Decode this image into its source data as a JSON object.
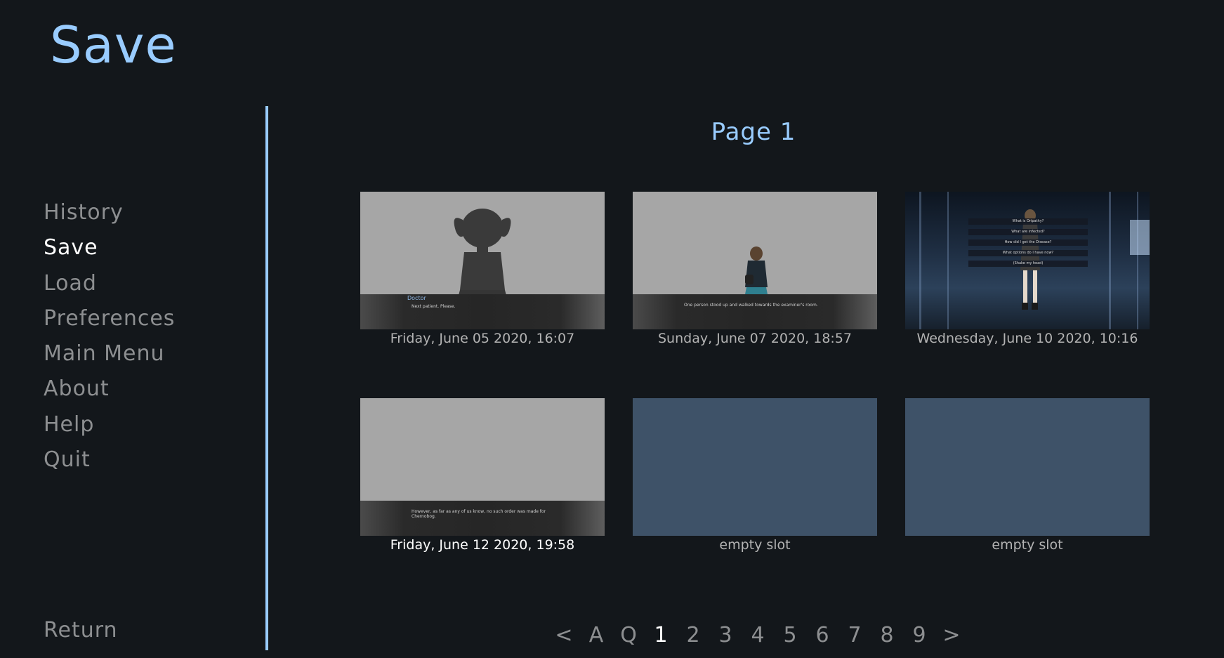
{
  "screen": {
    "title": "Save",
    "page_title": "Page 1"
  },
  "nav": {
    "items": [
      {
        "label": "History",
        "active": false
      },
      {
        "label": "Save",
        "active": true
      },
      {
        "label": "Load",
        "active": false
      },
      {
        "label": "Preferences",
        "active": false
      },
      {
        "label": "Main Menu",
        "active": false
      },
      {
        "label": "About",
        "active": false
      },
      {
        "label": "Help",
        "active": false
      },
      {
        "label": "Quit",
        "active": false
      }
    ],
    "return_label": "Return"
  },
  "slots": [
    {
      "label": "Friday, June 05 2020, 16:07",
      "speaker": "Doctor",
      "line": "Next patient. Please."
    },
    {
      "label": "Sunday, June 07 2020, 18:57",
      "line": "One person stood up and walked towards the examiner's room."
    },
    {
      "label": "Wednesday, June 10 2020, 10:16",
      "choices": [
        "What is Oripathy?",
        "What are infected?",
        "How did I get the Disease?",
        "What options do I have now?",
        "(Shake my head)"
      ]
    },
    {
      "label": "Friday, June 12 2020, 19:58",
      "line": "However, as far as any of us know, no such order was made for Chernobog."
    },
    {
      "label": "empty slot"
    },
    {
      "label": "empty slot"
    }
  ],
  "pager": {
    "prev": "<",
    "auto": "A",
    "quick": "Q",
    "pages": [
      "1",
      "2",
      "3",
      "4",
      "5",
      "6",
      "7",
      "8",
      "9"
    ],
    "next": ">",
    "current": "1"
  },
  "colors": {
    "accent": "#99ccff",
    "background": "#13171b",
    "empty_slot": "#3e5268",
    "idle_text": "#8d8f91"
  }
}
